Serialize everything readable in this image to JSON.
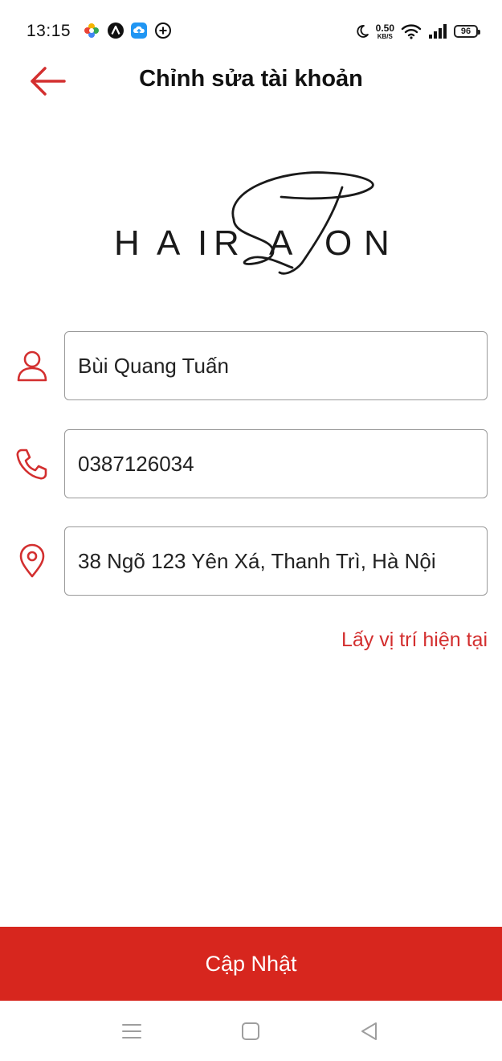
{
  "status_bar": {
    "time": "13:15",
    "net_speed_value": "0.50",
    "net_speed_unit": "KB/S",
    "battery": "96",
    "icons": [
      "pinwheel-icon",
      "app-a-icon",
      "cloud-upload-icon",
      "plus-circle-icon",
      "moon-icon",
      "wifi-icon",
      "signal-icon",
      "battery-icon"
    ]
  },
  "header": {
    "title": "Chỉnh sửa tài khoản",
    "back_icon": "arrow-left-icon"
  },
  "logo": {
    "text": "HAIRSALON"
  },
  "form": {
    "name": {
      "icon": "person-icon",
      "value": "Bùi Quang Tuấn"
    },
    "phone": {
      "icon": "phone-icon",
      "value": "0387126034"
    },
    "address": {
      "icon": "location-pin-icon",
      "value": "38 Ngõ 123 Yên Xá, Thanh Trì, Hà Nội"
    },
    "locate_label": "Lấy vị trí hiện tại"
  },
  "update_button": {
    "label": "Cập Nhật"
  },
  "nav_bar": {
    "icons": [
      "menu-icon",
      "home-square-icon",
      "back-triangle-icon"
    ]
  },
  "colors": {
    "accent": "#d32f2f",
    "button_bg": "#d7261e",
    "border": "#9a9a9a"
  }
}
